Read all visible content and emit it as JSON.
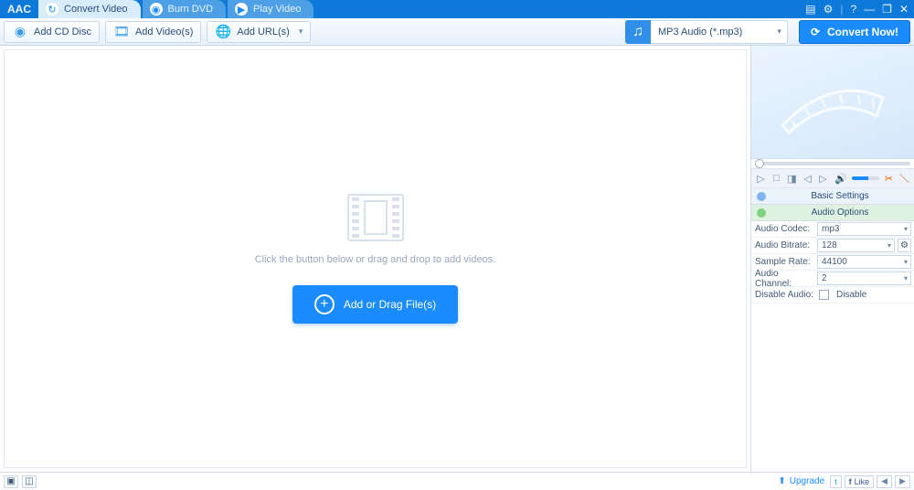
{
  "titlebar": {
    "brand": "AAC"
  },
  "tabs": [
    {
      "label": "Convert Video",
      "icon": "refresh",
      "active": true
    },
    {
      "label": "Burn DVD",
      "icon": "disc",
      "active": false
    },
    {
      "label": "Play Video",
      "icon": "play",
      "active": false
    }
  ],
  "toolbar": {
    "add_cd": "Add CD Disc",
    "add_videos": "Add Video(s)",
    "add_urls": "Add URL(s)",
    "format": "MP3 Audio (*.mp3)",
    "convert": "Convert Now!"
  },
  "drop": {
    "hint": "Click the button below or drag and drop to add videos.",
    "button": "Add or Drag File(s)"
  },
  "accordion": {
    "basic": "Basic Settings",
    "audio": "Audio Options"
  },
  "settings": {
    "codec_label": "Audio Codec:",
    "codec_value": "mp3",
    "bitrate_label": "Audio Bitrate:",
    "bitrate_value": "128",
    "samplerate_label": "Sample Rate:",
    "samplerate_value": "44100",
    "channel_label": "Audio Channel:",
    "channel_value": "2",
    "disable_label": "Disable Audio:",
    "disable_value": "Disable"
  },
  "statusbar": {
    "upgrade": "Upgrade",
    "like": "Like"
  }
}
